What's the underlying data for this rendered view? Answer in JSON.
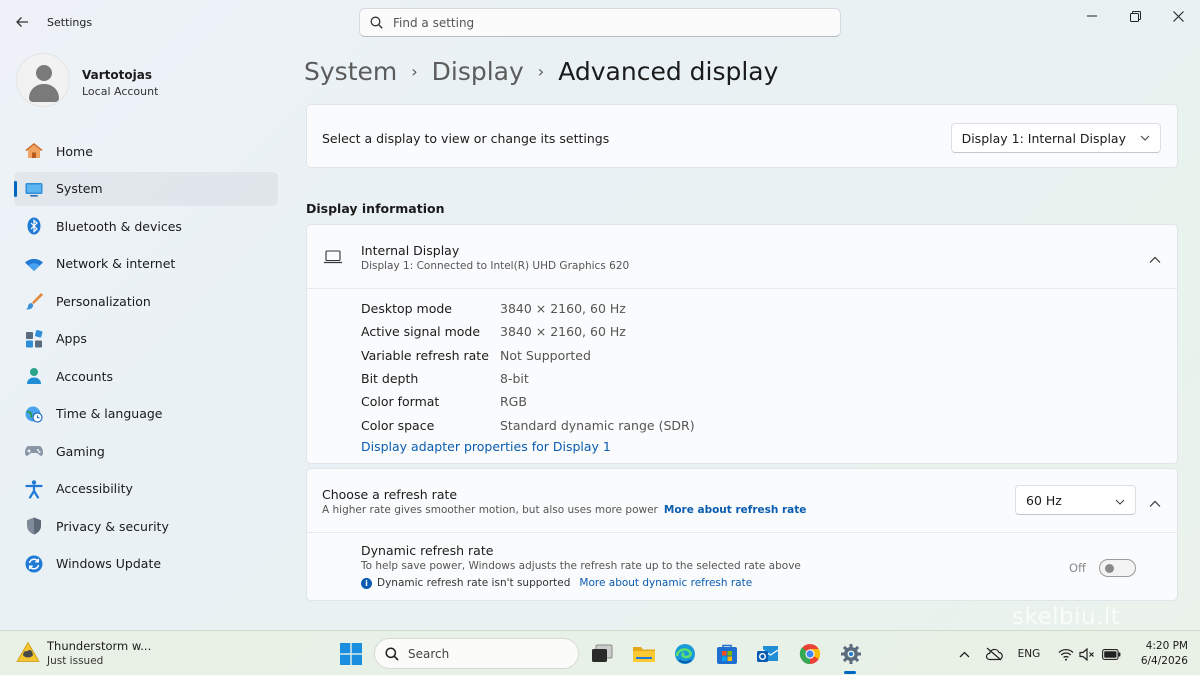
{
  "window": {
    "app_title": "Settings",
    "search_placeholder": "Find a setting"
  },
  "profile": {
    "name": "Vartotojas",
    "account_type": "Local Account"
  },
  "sidebar": {
    "items": [
      {
        "label": "Home",
        "icon": "home-icon"
      },
      {
        "label": "System",
        "icon": "system-icon",
        "active": true
      },
      {
        "label": "Bluetooth & devices",
        "icon": "bluetooth-icon"
      },
      {
        "label": "Network & internet",
        "icon": "wifi-icon"
      },
      {
        "label": "Personalization",
        "icon": "brush-icon"
      },
      {
        "label": "Apps",
        "icon": "apps-icon"
      },
      {
        "label": "Accounts",
        "icon": "accounts-icon"
      },
      {
        "label": "Time & language",
        "icon": "globe-clock-icon"
      },
      {
        "label": "Gaming",
        "icon": "gamepad-icon"
      },
      {
        "label": "Accessibility",
        "icon": "accessibility-icon"
      },
      {
        "label": "Privacy & security",
        "icon": "shield-icon"
      },
      {
        "label": "Windows Update",
        "icon": "update-icon"
      }
    ]
  },
  "breadcrumb": {
    "items": [
      "System",
      "Display",
      "Advanced display"
    ],
    "separator": "›"
  },
  "display_select": {
    "label": "Select a display to view or change its settings",
    "selected": "Display 1: Internal Display"
  },
  "display_info": {
    "heading": "Display information",
    "title": "Internal Display",
    "subtitle": "Display 1: Connected to Intel(R) UHD Graphics 620",
    "rows": [
      {
        "key": "Desktop mode",
        "value": "3840 × 2160, 60 Hz"
      },
      {
        "key": "Active signal mode",
        "value": "3840 × 2160, 60 Hz"
      },
      {
        "key": "Variable refresh rate",
        "value": "Not Supported"
      },
      {
        "key": "Bit depth",
        "value": "8-bit"
      },
      {
        "key": "Color format",
        "value": "RGB"
      },
      {
        "key": "Color space",
        "value": "Standard dynamic range (SDR)"
      }
    ],
    "adapter_link": "Display adapter properties for Display 1"
  },
  "refresh_rate": {
    "title": "Choose a refresh rate",
    "subtitle": "A higher rate gives smoother motion, but also uses more power",
    "more_link": "More about refresh rate",
    "selected": "60 Hz",
    "dynamic": {
      "title": "Dynamic refresh rate",
      "subtitle": "To help save power, Windows adjusts the refresh rate up to the selected rate above",
      "note": "Dynamic refresh rate isn't supported",
      "more_link": "More about dynamic refresh rate",
      "toggle_label": "Off",
      "toggle_on": false
    }
  },
  "watermark": "skelbiu.lt",
  "taskbar": {
    "weather_title": "Thunderstorm w...",
    "weather_sub": "Just issued",
    "search_label": "Search",
    "language": "ENG",
    "time": "4:20 PM",
    "date": "6/4/2026"
  },
  "colors": {
    "accent": "#0067c0",
    "link": "#0a5cb0"
  }
}
